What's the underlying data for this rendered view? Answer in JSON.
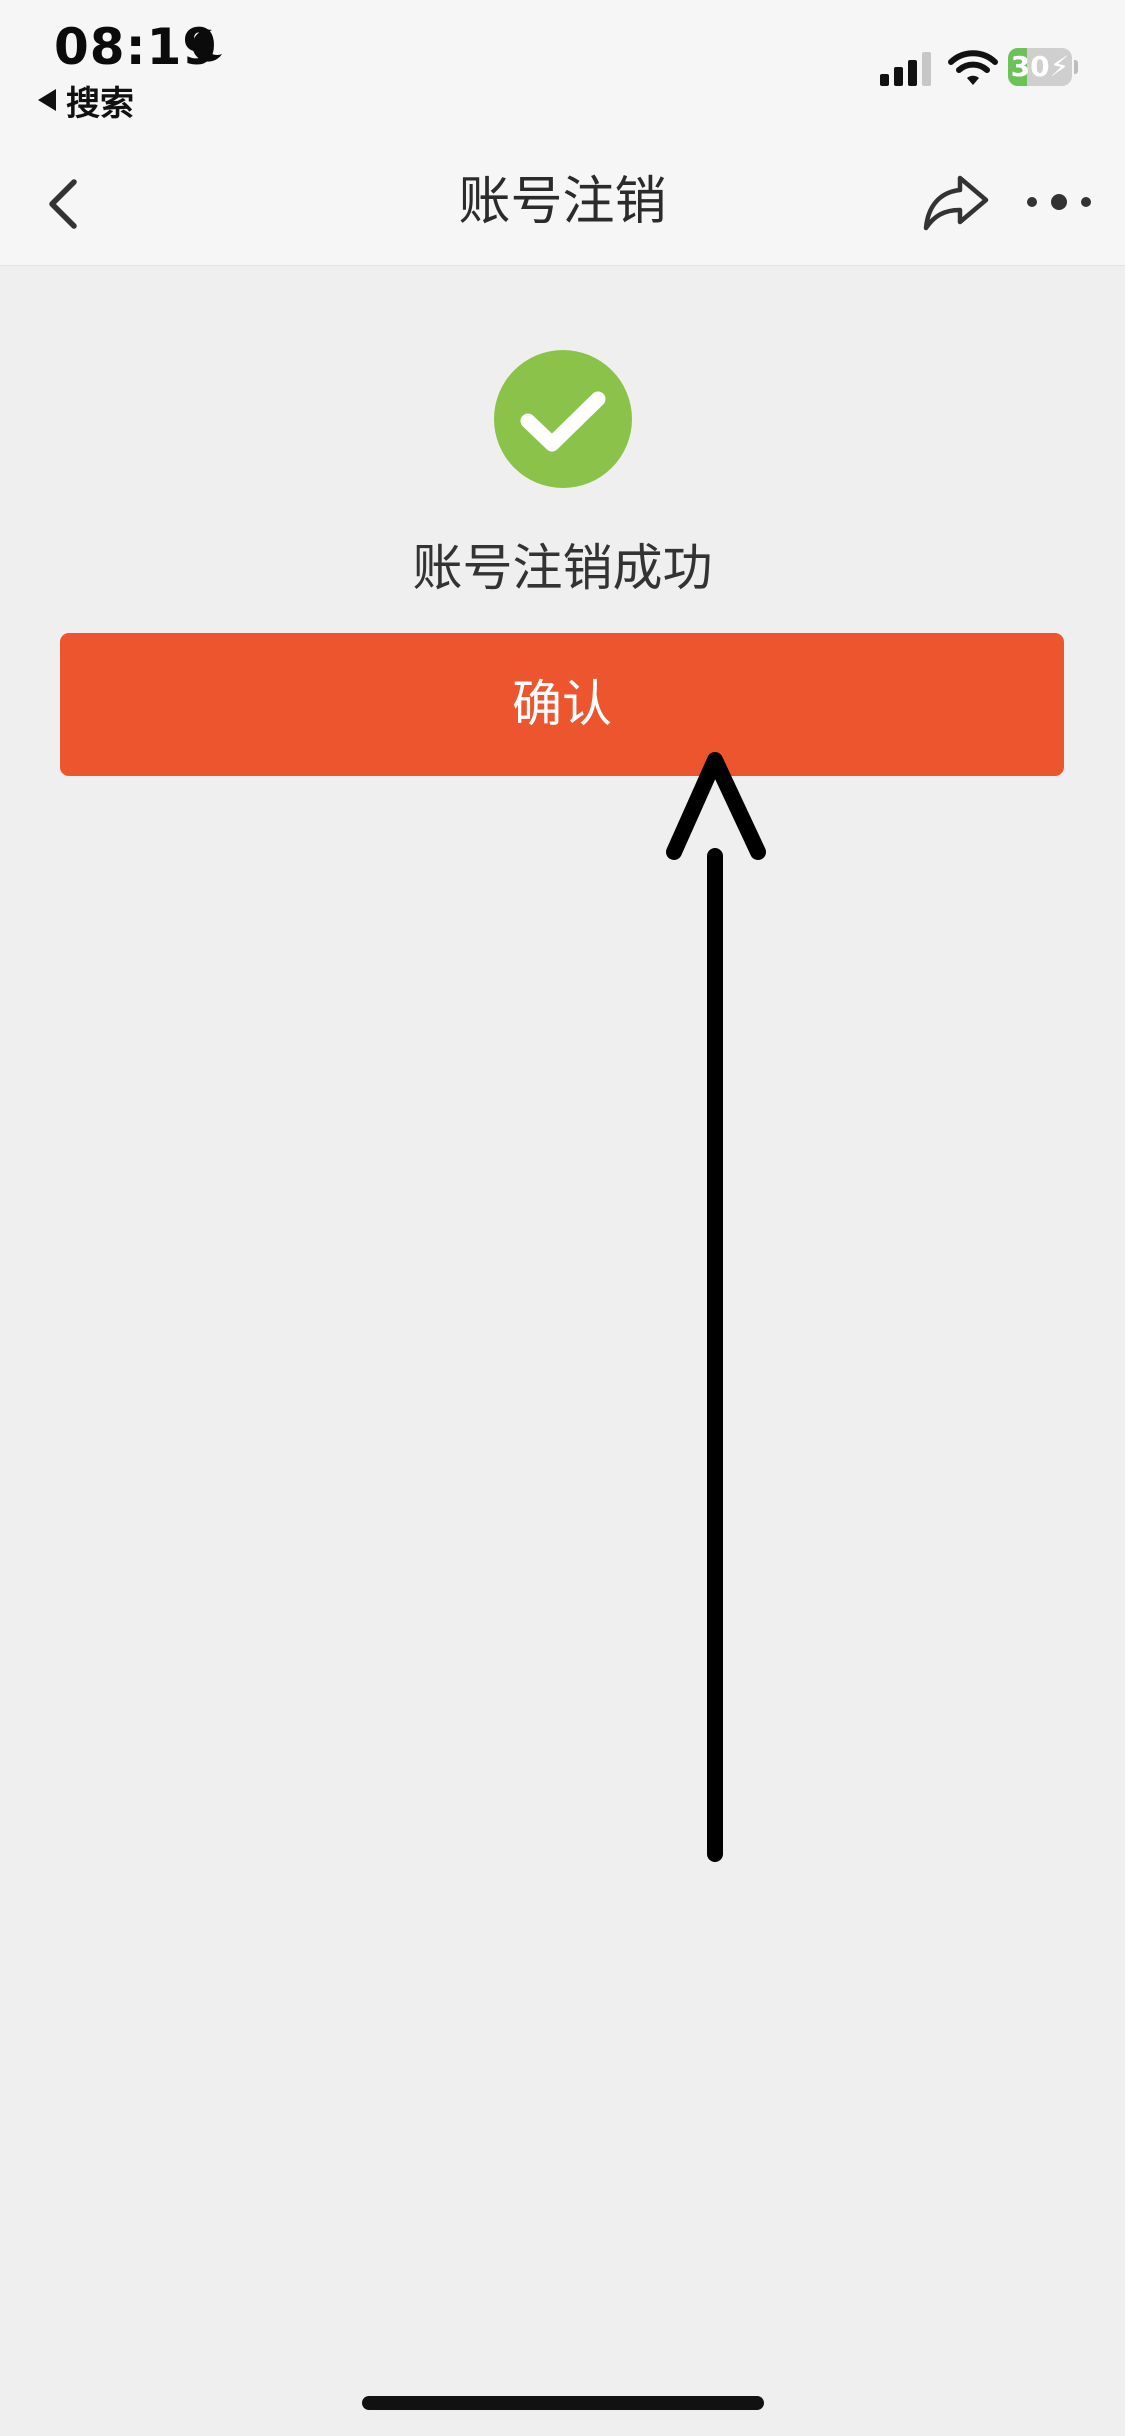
{
  "status_bar": {
    "time": "08:19",
    "back_label": "搜索",
    "battery_level": "30",
    "battery_fraction": 0.3,
    "icons": [
      "moon-icon",
      "cellular-signal-icon",
      "wifi-icon",
      "battery-icon"
    ]
  },
  "nav": {
    "title": "账号注销",
    "icons": [
      "chevron-left-icon",
      "share-icon",
      "more-icon"
    ]
  },
  "content": {
    "success_message": "账号注销成功",
    "confirm_label": "确认",
    "success_icon": "check-circle-icon"
  },
  "colors": {
    "accent": "#ec552d",
    "success": "#8bc34a",
    "background": "#efefef",
    "battery_green": "#6cc259"
  }
}
